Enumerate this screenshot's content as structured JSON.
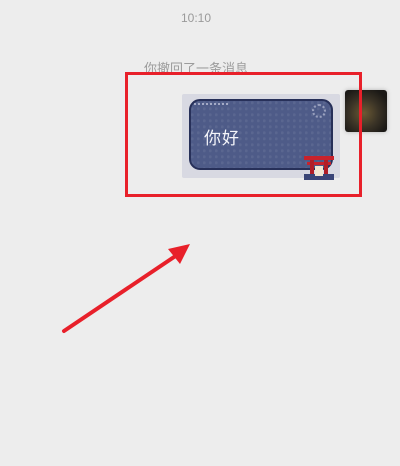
{
  "chat": {
    "timestamp": "10:10",
    "recall_notice": "你撤回了一条消息",
    "message": {
      "type": "sticker",
      "sticker_text": "你好"
    }
  },
  "annotation": {
    "highlight_color": "#e8202a",
    "arrow_color": "#e8202a"
  },
  "colors": {
    "background": "#ededed",
    "sticker_card": "#4e5b88",
    "sticker_border": "#273059"
  }
}
